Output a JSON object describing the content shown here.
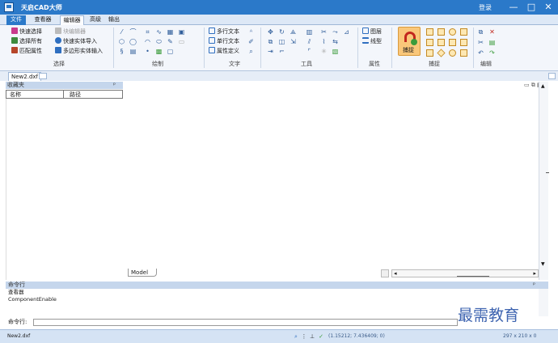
{
  "window": {
    "title": "天启CAD大师",
    "login": "登录",
    "minimize": "—",
    "maximize": "□",
    "close": "✕"
  },
  "menu_tabs": [
    "文件",
    "查看器",
    "编辑器",
    "高级",
    "输出"
  ],
  "active_tab": "编辑器",
  "ribbon": {
    "select": {
      "label": "选择",
      "items": [
        "快速选择",
        "块编辑器",
        "选择所有",
        "快速实体导入",
        "匹配属性",
        "多边形实体输入"
      ]
    },
    "draw_label": "绘制",
    "text": {
      "label": "文字",
      "items": [
        "多行文本",
        "单行文本",
        "属性定义"
      ]
    },
    "tools_label": "工具",
    "props": {
      "label": "属性",
      "items": [
        "图层",
        "线型"
      ]
    },
    "snap": {
      "label": "捕捉",
      "big_button": "捕捉"
    },
    "edit_label": "编辑"
  },
  "document_tab": "New2.dxf",
  "favorites": {
    "title": "收藏夹",
    "col_name": "名称",
    "col_path": "路径"
  },
  "model_tab": "Model",
  "command": {
    "title": "命令行",
    "lines": [
      "查看器",
      "ComponentEnable"
    ],
    "prompt": "命令行:"
  },
  "status": {
    "file": "New2.dxf",
    "coords": "(1.15212; 7.436409; 0)",
    "sheet_size": "297 x 210 x 0"
  },
  "watermark": "最需教育",
  "colors": {
    "titlebar": "#2b79c9",
    "ribbon_bg": "#f3f6fb",
    "snap_highlight": "#f9c77a",
    "statusbar": "#d5e3f4"
  }
}
